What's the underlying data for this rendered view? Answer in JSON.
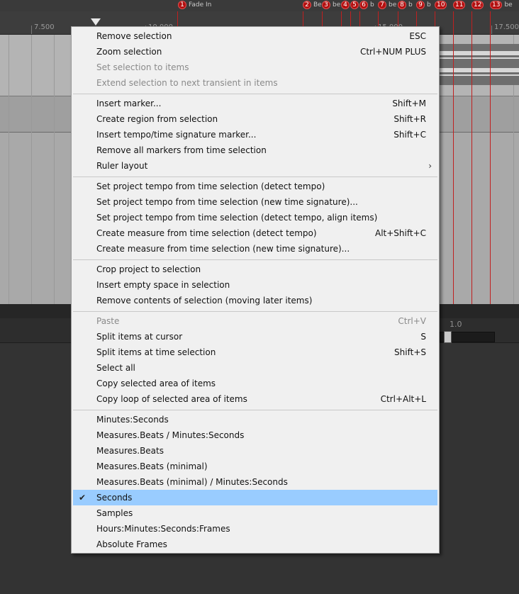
{
  "ruler": {
    "labels": [
      "7.500",
      "10.000",
      "15.000",
      "17.500"
    ]
  },
  "markers": [
    {
      "num": "1",
      "name": "Fade In"
    },
    {
      "num": "2",
      "name": "Be"
    },
    {
      "num": "3",
      "name": "be"
    },
    {
      "num": "4",
      "name": ""
    },
    {
      "num": "5",
      "name": ""
    },
    {
      "num": "6",
      "name": "b"
    },
    {
      "num": "7",
      "name": "be"
    },
    {
      "num": "8",
      "name": "b"
    },
    {
      "num": "9",
      "name": "b"
    },
    {
      "num": "10",
      "name": ""
    },
    {
      "num": "11",
      "name": ""
    },
    {
      "num": "12",
      "name": ""
    },
    {
      "num": "13",
      "name": "be"
    }
  ],
  "slider": {
    "value_text": "1.0"
  },
  "menu": {
    "items": [
      {
        "label": "Remove selection",
        "shortcut": "ESC"
      },
      {
        "label": "Zoom selection",
        "shortcut": "Ctrl+NUM PLUS"
      },
      {
        "label": "Set selection to items",
        "shortcut": ""
      },
      {
        "label": "Extend selection to next transient in items",
        "shortcut": ""
      },
      {
        "label": "Insert marker...",
        "shortcut": "Shift+M"
      },
      {
        "label": "Create region from selection",
        "shortcut": "Shift+R"
      },
      {
        "label": "Insert tempo/time signature marker...",
        "shortcut": "Shift+C"
      },
      {
        "label": "Remove all markers from time selection",
        "shortcut": ""
      },
      {
        "label": "Ruler layout",
        "shortcut": ""
      },
      {
        "label": "Set project tempo from time selection (detect tempo)",
        "shortcut": ""
      },
      {
        "label": "Set project tempo from time selection (new time signature)...",
        "shortcut": ""
      },
      {
        "label": "Set project tempo from time selection (detect tempo, align items)",
        "shortcut": ""
      },
      {
        "label": "Create measure from time selection (detect tempo)",
        "shortcut": "Alt+Shift+C"
      },
      {
        "label": "Create measure from time selection (new time signature)...",
        "shortcut": ""
      },
      {
        "label": "Crop project to selection",
        "shortcut": ""
      },
      {
        "label": "Insert empty space in selection",
        "shortcut": ""
      },
      {
        "label": "Remove contents of selection (moving later items)",
        "shortcut": ""
      },
      {
        "label": "Paste",
        "shortcut": "Ctrl+V"
      },
      {
        "label": "Split items at cursor",
        "shortcut": "S"
      },
      {
        "label": "Split items at time selection",
        "shortcut": "Shift+S"
      },
      {
        "label": "Select all",
        "shortcut": ""
      },
      {
        "label": "Copy selected area of items",
        "shortcut": ""
      },
      {
        "label": "Copy loop of selected area of items",
        "shortcut": "Ctrl+Alt+L"
      },
      {
        "label": "Minutes:Seconds",
        "shortcut": ""
      },
      {
        "label": "Measures.Beats / Minutes:Seconds",
        "shortcut": ""
      },
      {
        "label": "Measures.Beats",
        "shortcut": ""
      },
      {
        "label": "Measures.Beats (minimal)",
        "shortcut": ""
      },
      {
        "label": "Measures.Beats (minimal) / Minutes:Seconds",
        "shortcut": ""
      },
      {
        "label": "Seconds",
        "shortcut": ""
      },
      {
        "label": "Samples",
        "shortcut": ""
      },
      {
        "label": "Hours:Minutes:Seconds:Frames",
        "shortcut": ""
      },
      {
        "label": "Absolute Frames",
        "shortcut": ""
      }
    ],
    "disabled_items": [
      "Set selection to items",
      "Extend selection to next transient in items",
      "Paste"
    ],
    "checked_item": "Seconds",
    "submenu_items": [
      "Ruler layout"
    ],
    "icons": {
      "check": "checkmark-icon",
      "submenu": "chevron-right-icon"
    },
    "colors": {
      "selected_background": "#99ccff",
      "marker_red": "#b30f0f"
    }
  }
}
